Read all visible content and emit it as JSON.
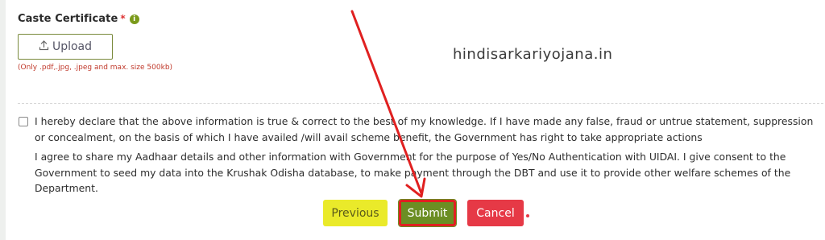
{
  "field": {
    "label": "Caste Certificate",
    "required_mark": "*",
    "info_glyph": "i"
  },
  "upload": {
    "label": "Upload",
    "icon": "upload-icon",
    "hint": "(Only .pdf,.jpg, .jpeg and max. size 500kb)"
  },
  "watermark": "hindisarkariyojana.in",
  "declarations": [
    "I hereby declare that the above information is true & correct to the best of my knowledge. If I have made any false, fraud or untrue statement, suppression or concealment, on the basis of which I have availed /will avail scheme benefit, the Government has right to take appropriate actions",
    "I agree to share my Aadhaar details and other information with Government for the purpose of Yes/No Authentication with UIDAI. I give consent to the Government to seed my data into the Krushak Odisha database, to make payment through the DBT and use it to provide other welfare schemes of the Department."
  ],
  "buttons": {
    "previous": "Previous",
    "submit": "Submit",
    "cancel": "Cancel"
  },
  "colors": {
    "submit": "#6b8e23",
    "previous": "#eaea2a",
    "cancel": "#e63946",
    "annotation": "#e02020"
  }
}
